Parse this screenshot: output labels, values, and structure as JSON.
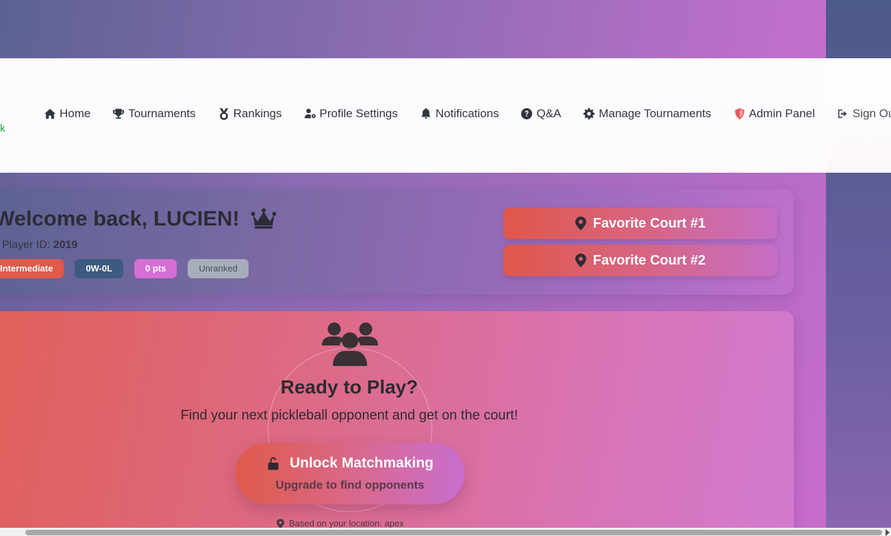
{
  "nav": {
    "cut_label": "k",
    "items": [
      {
        "label": "Home",
        "icon": "home-icon"
      },
      {
        "label": "Tournaments",
        "icon": "trophy-icon"
      },
      {
        "label": "Rankings",
        "icon": "medal-icon"
      },
      {
        "label": "Profile Settings",
        "icon": "user-gear-icon"
      },
      {
        "label": "Notifications",
        "icon": "bell-icon"
      },
      {
        "label": "Q&A",
        "icon": "question-circle-icon"
      },
      {
        "label": "Manage Tournaments",
        "icon": "cog-icon"
      },
      {
        "label": "Admin Panel",
        "icon": "shield-icon"
      },
      {
        "label": "Sign Out",
        "icon": "sign-out-icon"
      }
    ]
  },
  "welcome": {
    "title": "Welcome back, LUCIEN!",
    "crown_icon": "crown-icon",
    "player_id_label": "Player ID:",
    "player_id": "2019",
    "badges": {
      "level": "Intermediate",
      "record": "0W-0L",
      "points": "0 pts",
      "rank": "Unranked"
    }
  },
  "courts": {
    "court1": "Favorite Court #1",
    "court2": "Favorite Court #2"
  },
  "play": {
    "icon": "users-group-icon",
    "title": "Ready to Play?",
    "subtitle": "Find your next pickleball opponent and get on the court!",
    "button_label": "Unlock Matchmaking",
    "button_sub": "Upgrade to find opponents",
    "location_text": "Based on your location: apex"
  },
  "colors": {
    "accent_red": "#e05a4c",
    "accent_pink": "#d46fd6",
    "record_blue": "#3d5a80",
    "rank_gray": "#a8adbb",
    "admin_icon": "#ea5a5a"
  }
}
